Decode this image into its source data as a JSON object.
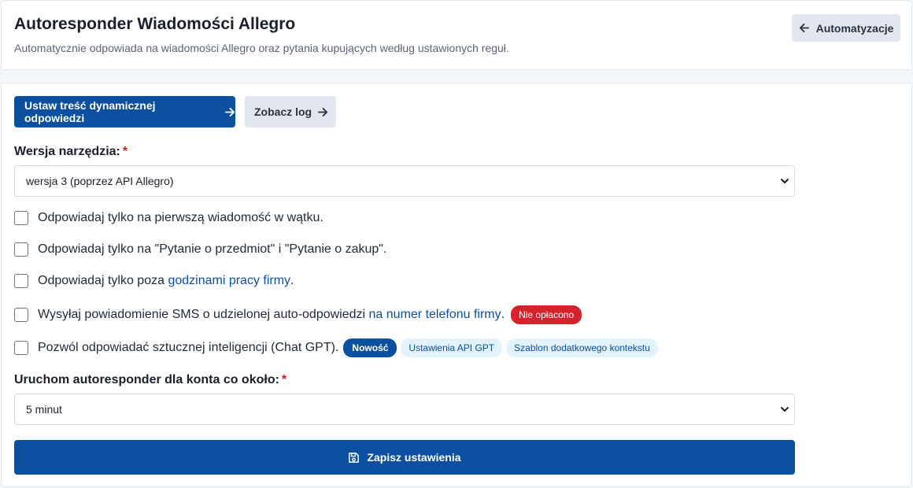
{
  "header": {
    "title": "Autoresponder Wiadomości Allegro",
    "subtitle": "Automatycznie odpowiada na wiadomości Allegro oraz pytania kupujących według ustawionych reguł.",
    "back_label": "Automatyzacje"
  },
  "toolbar": {
    "primary_label": "Ustaw treść dynamicznej odpowiedzi",
    "log_label": "Zobacz log"
  },
  "version_field": {
    "label": "Wersja narzędzia:",
    "required_mark": "*",
    "selected": "wersja 3 (poprzez API Allegro)"
  },
  "options": {
    "first_message": "Odpowiadaj tylko na pierwszą wiadomość w wątku.",
    "questions_only": "Odpowiadaj tylko na \"Pytanie o przedmiot\" i \"Pytanie o zakup\".",
    "outside_hours_prefix": "Odpowiadaj tylko poza ",
    "outside_hours_link": "godzinami pracy firmy",
    "outside_hours_suffix": ".",
    "sms_prefix": "Wysyłaj powiadomienie SMS o udzielonej auto-odpowiedzi ",
    "sms_link": "na numer telefonu firmy",
    "sms_suffix": ".",
    "sms_badge": "Nie opłacono",
    "ai_text": "Pozwól odpowiadać sztucznej inteligencji (Chat GPT).",
    "ai_badge_new": "Nowość",
    "ai_badge_api": "Ustawienia API GPT",
    "ai_badge_template": "Szablon dodatkowego kontekstu"
  },
  "interval_field": {
    "label": "Uruchom autoresponder dla konta co około:",
    "required_mark": "*",
    "selected": "5 minut"
  },
  "save_label": "Zapisz ustawienia",
  "colors": {
    "primary": "#0b4fa0",
    "danger": "#d6222a",
    "badge_light": "#e2f3fb"
  }
}
